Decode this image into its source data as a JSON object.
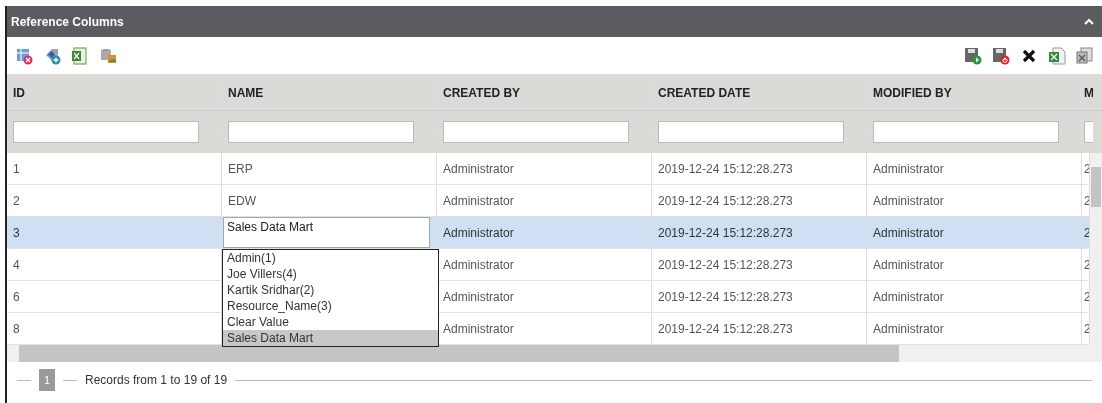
{
  "panel": {
    "title": "Reference Columns",
    "collapsed": false
  },
  "toolbar": {
    "left": [
      {
        "kind": "table-delete"
      },
      {
        "kind": "tag-add"
      },
      {
        "kind": "sheet"
      },
      {
        "kind": "db-transfer"
      }
    ],
    "right": [
      {
        "kind": "save-go"
      },
      {
        "kind": "save-stop"
      },
      {
        "kind": "close"
      },
      {
        "kind": "excel"
      },
      {
        "kind": "export"
      }
    ]
  },
  "table": {
    "columns": [
      "ID",
      "NAME",
      "CREATED BY",
      "CREATED DATE",
      "MODIFIED BY",
      "M"
    ],
    "rows": [
      {
        "cells": [
          "1",
          "ERP",
          "Administrator",
          "2019-12-24 15:12:28.273",
          "Administrator",
          "2"
        ],
        "selected": false,
        "editing": false
      },
      {
        "cells": [
          "2",
          "EDW",
          "Administrator",
          "2019-12-24 15:12:28.273",
          "Administrator",
          "2"
        ],
        "selected": false,
        "editing": false
      },
      {
        "cells": [
          "3",
          "Sales Data Mart",
          "Administrator",
          "2019-12-24 15:12:28.273",
          "Administrator",
          "2"
        ],
        "selected": true,
        "editing": true
      },
      {
        "cells": [
          "4",
          "",
          "Administrator",
          "2019-12-24 15:12:28.273",
          "Administrator",
          "2"
        ],
        "selected": false,
        "editing": false
      },
      {
        "cells": [
          "6",
          "",
          "Administrator",
          "2019-12-24 15:12:28.273",
          "Administrator",
          "2"
        ],
        "selected": false,
        "editing": false
      },
      {
        "cells": [
          "8",
          "",
          "Administrator",
          "2019-12-24 15:12:28.273",
          "Administrator",
          "2"
        ],
        "selected": false,
        "editing": false
      }
    ]
  },
  "dropdown": {
    "options": [
      {
        "label": "Admin(1)",
        "selected": false
      },
      {
        "label": "Joe Villers(4)",
        "selected": false
      },
      {
        "label": "Kartik Sridhar(2)",
        "selected": false
      },
      {
        "label": "Resource_Name(3)",
        "selected": false
      },
      {
        "label": "Clear Value",
        "selected": false
      },
      {
        "label": "Sales Data Mart",
        "selected": true
      }
    ]
  },
  "pager": {
    "page": "1",
    "records": "Records from 1 to 19 of 19"
  }
}
